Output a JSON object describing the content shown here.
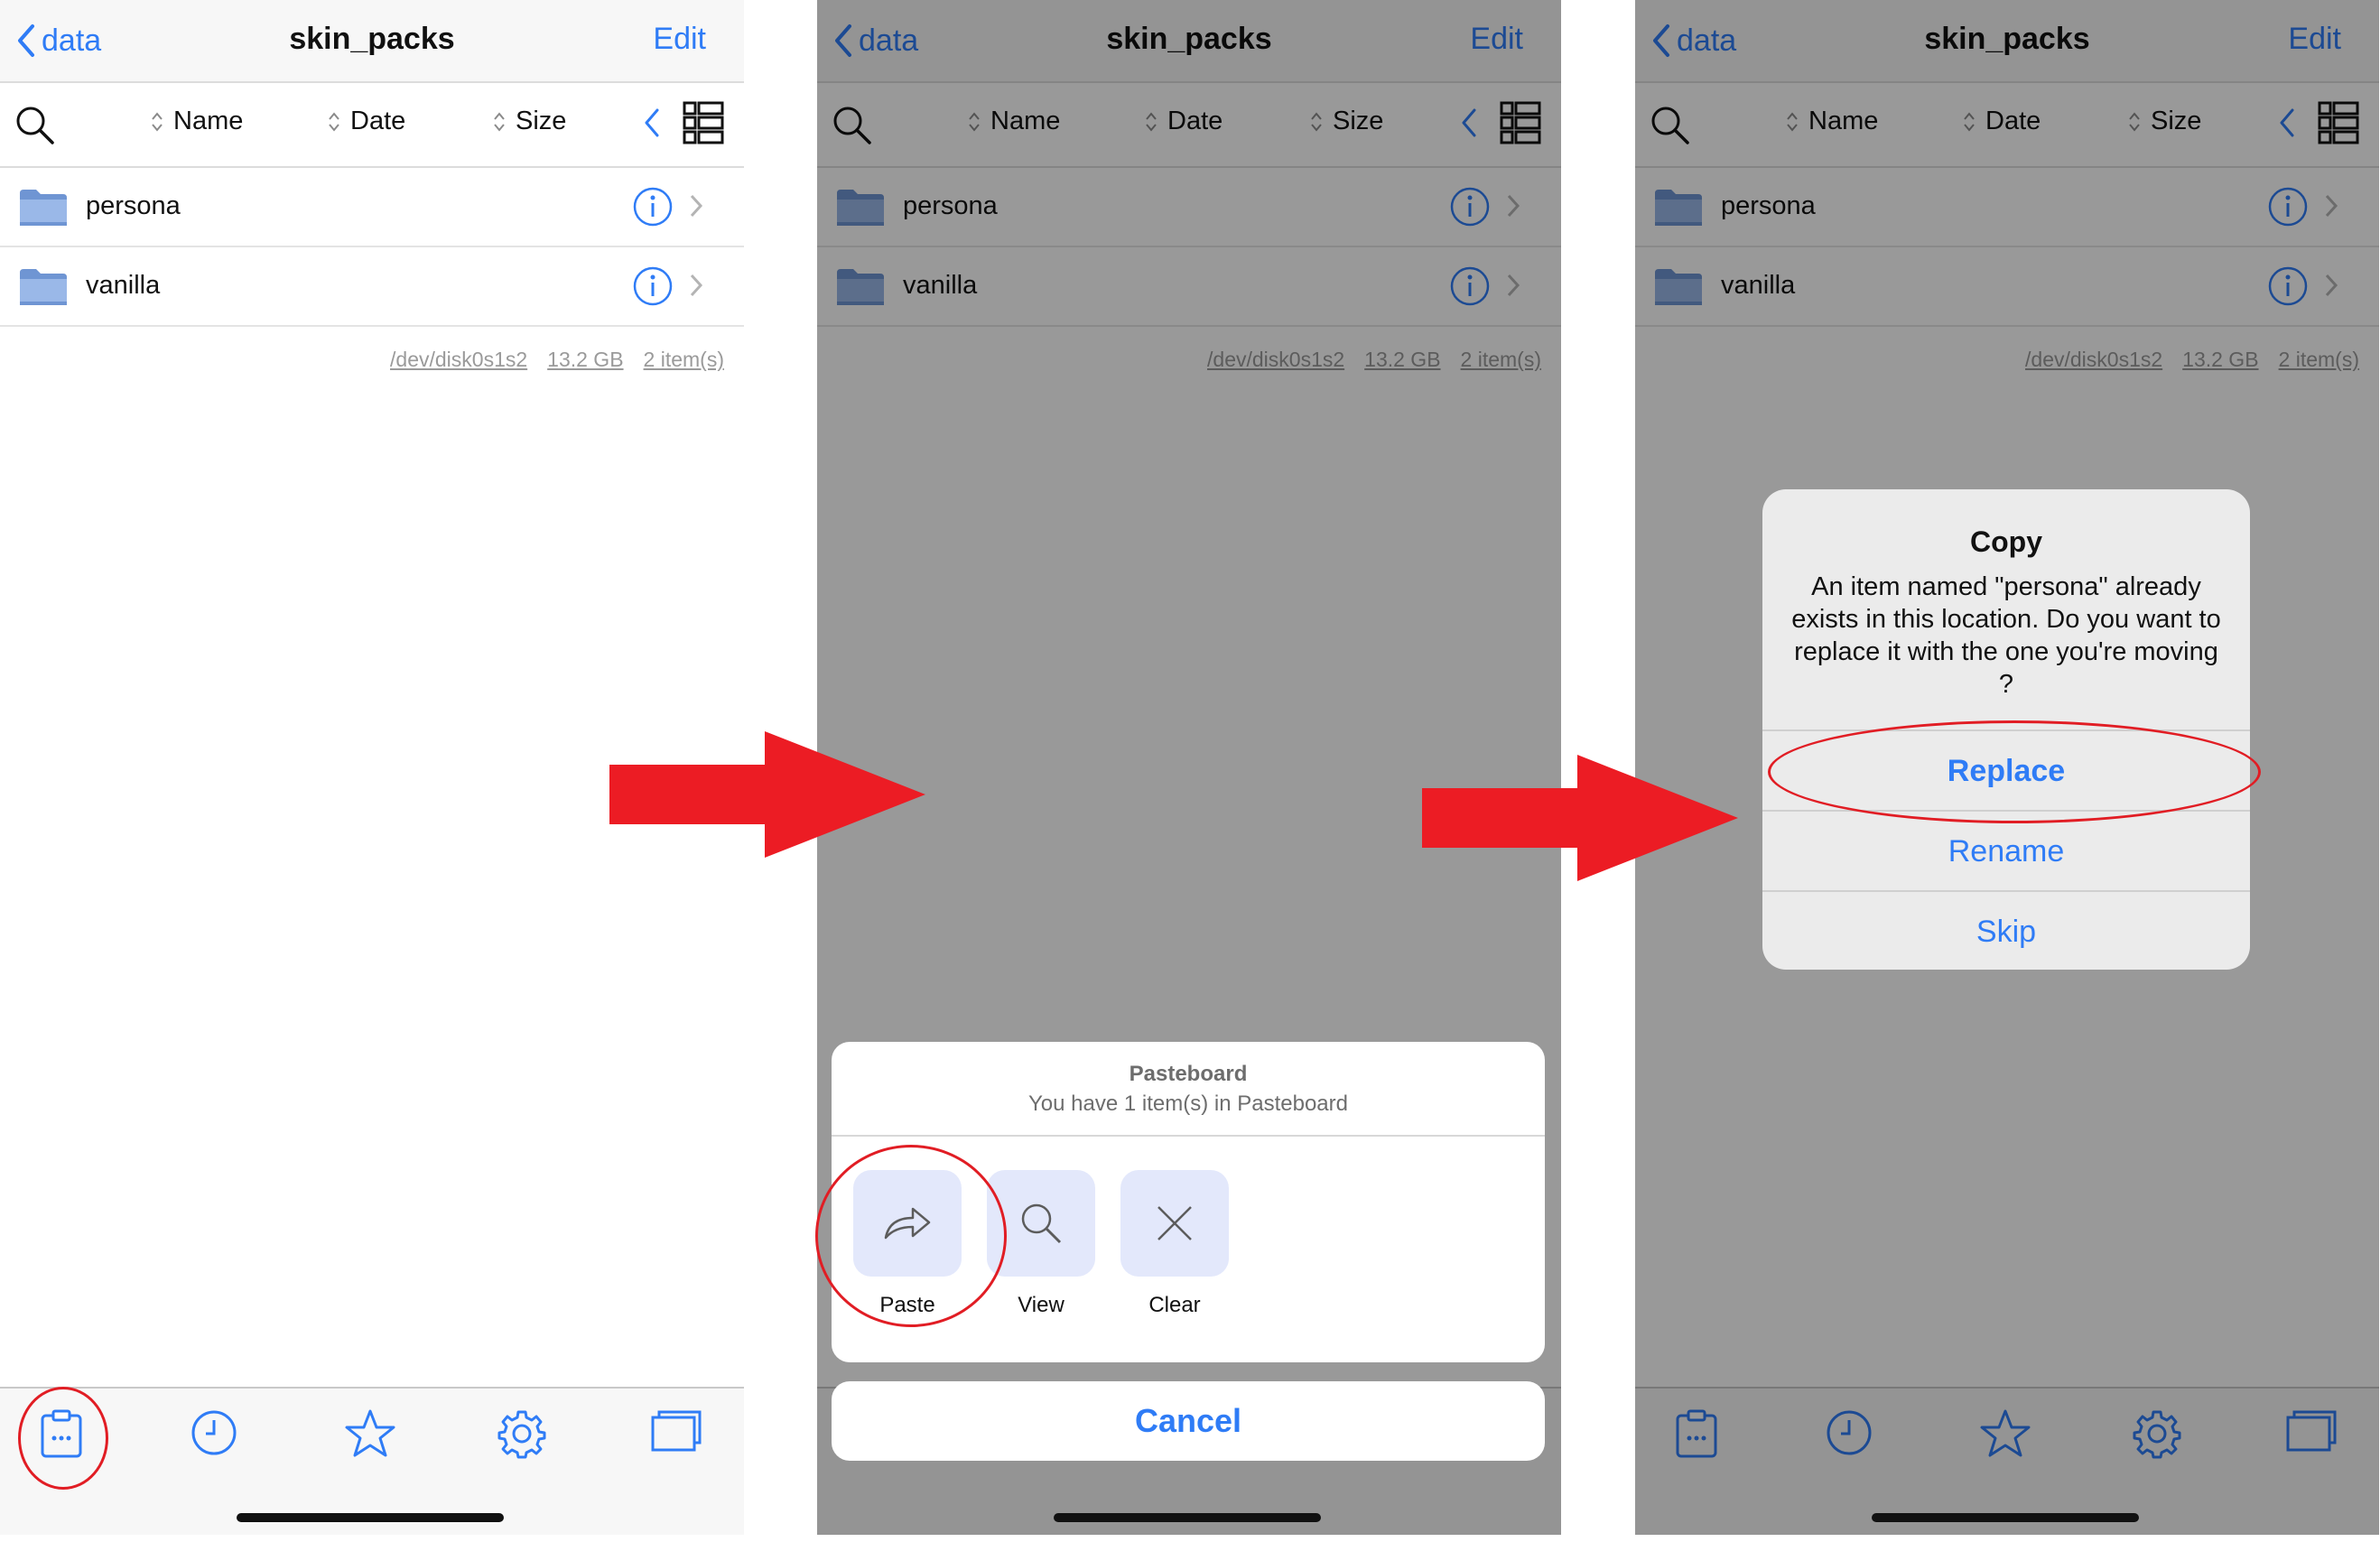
{
  "nav": {
    "back_label": "data",
    "title": "skin_packs",
    "edit_label": "Edit"
  },
  "sort": {
    "name": "Name",
    "date": "Date",
    "size": "Size"
  },
  "files": [
    {
      "name": "persona"
    },
    {
      "name": "vanilla"
    }
  ],
  "footer": {
    "device": "/dev/disk0s1s2",
    "free": "13.2 GB",
    "count": "2 item(s)"
  },
  "tabs": [
    "clipboard-icon",
    "clock-icon",
    "star-icon",
    "gear-icon",
    "windows-icon"
  ],
  "pasteboard": {
    "title": "Pasteboard",
    "subtitle": "You have 1 item(s) in Pasteboard",
    "actions": [
      {
        "label": "Paste",
        "icon": "share-arrow-icon"
      },
      {
        "label": "View",
        "icon": "magnifier-icon"
      },
      {
        "label": "Clear",
        "icon": "x-icon"
      }
    ],
    "cancel_label": "Cancel"
  },
  "alert": {
    "title": "Copy",
    "message": "An item named \"persona\" already exists in this location. Do you want to replace it with the one you're moving ?",
    "buttons": [
      "Replace",
      "Rename",
      "Skip"
    ]
  },
  "colors": {
    "accent": "#2f7cf6",
    "annotation_red": "#e11d24",
    "folder": "#6f95d3",
    "overlay": "rgba(0,0,0,0.40)"
  }
}
